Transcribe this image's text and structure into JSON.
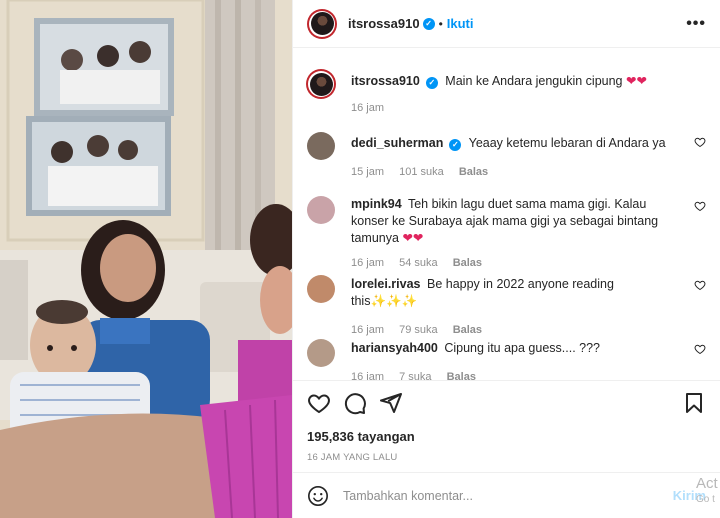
{
  "post": {
    "author": "itsrossa910",
    "follow_label": "Ikuti",
    "more_icon": "more-horizontal-icon",
    "caption_text": "Main ke Andara jengukin cipung",
    "caption_emoji": "❤❤",
    "caption_time": "16 jam"
  },
  "comments": [
    {
      "username": "dedi_suherman",
      "verified": true,
      "text": "Yeaay ketemu lebaran di Andara ya",
      "emoji": "",
      "time": "15 jam",
      "likes": "101 suka",
      "reply": "Balas",
      "avatar_color": "#7a6a5e"
    },
    {
      "username": "mpink94",
      "verified": false,
      "text": "Teh bikin lagu duet sama mama gigi. Kalau konser ke Surabaya ajak mama gigi ya sebagai bintang tamunya",
      "emoji": "❤❤",
      "time": "16 jam",
      "likes": "54 suka",
      "reply": "Balas",
      "avatar_color": "#c9a3a8"
    },
    {
      "username": "lorelei.rivas",
      "verified": false,
      "text": "Be happy in 2022 anyone reading this",
      "emoji": "✨✨✨",
      "time": "16 jam",
      "likes": "79 suka",
      "reply": "Balas",
      "avatar_color": "#c08a6a"
    },
    {
      "username": "hariansyah400",
      "verified": false,
      "text": "Cipung itu apa guess.... ???",
      "emoji": "",
      "time": "16 jam",
      "likes": "7 suka",
      "reply": "Balas",
      "avatar_color": "#b49a88"
    }
  ],
  "actions": {
    "views": "195,836 tayangan",
    "time_ago": "16 JAM YANG LALU"
  },
  "add_comment": {
    "placeholder": "Tambahkan komentar...",
    "send_label": "Kirim"
  },
  "watermark": {
    "line1": "Act",
    "line2": "Go t"
  },
  "colors": {
    "accent": "#0095f6",
    "heart": "#e0245e",
    "avatar_ring": "#c1272d"
  }
}
